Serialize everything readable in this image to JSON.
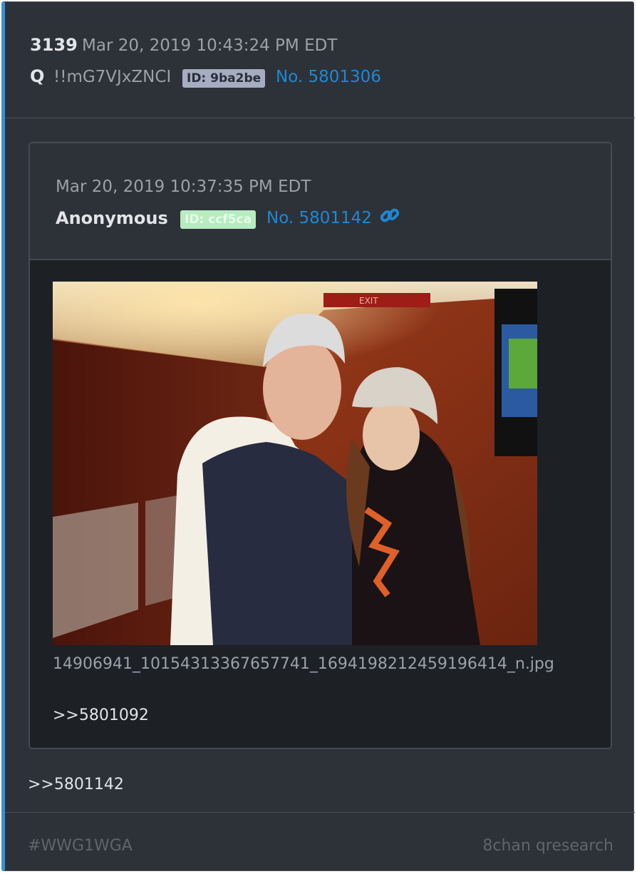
{
  "post": {
    "number": "3139",
    "date": "Mar 20, 2019 10:43:24 PM EDT",
    "author": "Q",
    "tripcode": "!!mG7VJxZNCI",
    "id_badge": "ID: 9ba2be",
    "post_no": "No. 5801306",
    "body_text": ">>5801142"
  },
  "quoted": {
    "date": "Mar 20, 2019 10:37:35 PM EDT",
    "author": "Anonymous",
    "id_badge": "ID: ccf5ca",
    "post_no": "No. 5801142",
    "link_icon": "link-icon",
    "filename": "14906941_10154313367657741_1694198212459196414_n.jpg",
    "body_text": ">>5801092"
  },
  "footer": {
    "hashtag": "#WWG1WGA",
    "source": "8chan qresearch"
  },
  "colors": {
    "accent": "#3a8fd8",
    "link": "#1e88d4",
    "background": "#2d3239",
    "quoted_background": "#1d2025"
  }
}
